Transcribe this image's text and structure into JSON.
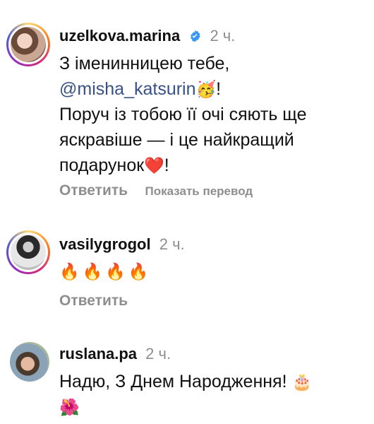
{
  "comments": [
    {
      "username": "uzelkova.marina",
      "time": "2 ч.",
      "verified": true,
      "text_line1": "З іменинницею тебе,",
      "mention": "@misha_katsurin",
      "after_mention_emoji": "🥳",
      "after_mention_text": "!",
      "text_line3": "Поруч із тобою її очі сяють ще",
      "text_line4": "яскравіше — і це найкращий",
      "text_line5_a": "подарунок",
      "text_line5_emoji": "❤️",
      "text_line5_b": "!",
      "reply_label": "Ответить",
      "translate_label": "Показать перевод"
    },
    {
      "username": "vasilygrogol",
      "time": "2 ч.",
      "emojis": "🔥🔥🔥🔥",
      "reply_label": "Ответить"
    },
    {
      "username": "ruslana.pa",
      "time": "2 ч.",
      "text_line1": "Надю, З Днем Народження!",
      "emoji1": "🎂",
      "emoji2": "🌺"
    }
  ],
  "colors": {
    "mention": "#385185",
    "secondary": "#8e8e8e",
    "verified": "#3897f0"
  }
}
